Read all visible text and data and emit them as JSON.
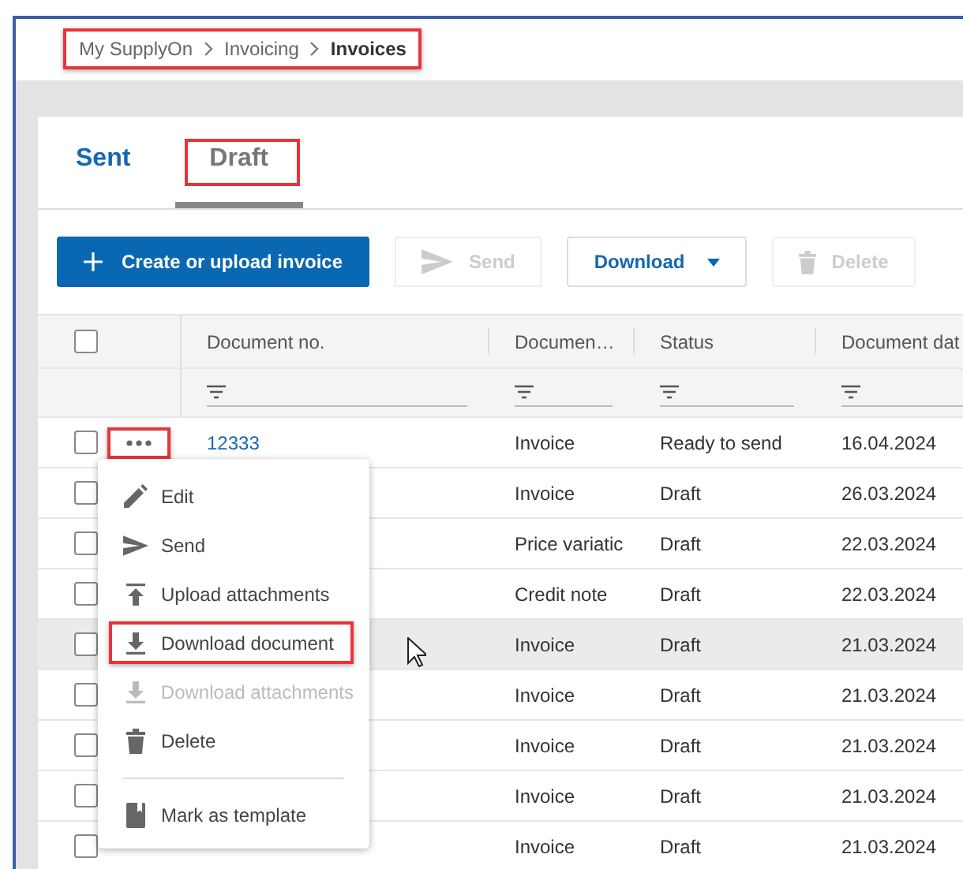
{
  "breadcrumb": {
    "highlighted": true,
    "items": [
      "My SupplyOn",
      "Invoicing",
      "Invoices"
    ]
  },
  "tabs": [
    {
      "label": "Sent",
      "selected": false,
      "highlighted": false
    },
    {
      "label": "Draft",
      "selected": true,
      "highlighted": true
    }
  ],
  "toolbar": [
    {
      "kind": "create",
      "label": "Create or upload invoice",
      "disabled": false
    },
    {
      "kind": "send",
      "label": "Send",
      "disabled": true
    },
    {
      "kind": "download",
      "label": "Download",
      "disabled": false
    },
    {
      "kind": "delete",
      "label": "Delete",
      "disabled": true
    }
  ],
  "table": {
    "select_all_checked": false,
    "columns": [
      "Document no.",
      "Documen…",
      "Status",
      "Document dat"
    ],
    "rows": [
      {
        "checked": false,
        "hovered": false,
        "document_no": "12333",
        "document_type": "Invoice",
        "status": "Ready to send",
        "document_date": "16.04.2024",
        "more_highlighted": true
      },
      {
        "checked": false,
        "hovered": false,
        "document_type": "Invoice",
        "status": "Draft",
        "document_date": "26.03.2024"
      },
      {
        "checked": false,
        "hovered": false,
        "document_type": "Price variatic",
        "status": "Draft",
        "document_date": "22.03.2024"
      },
      {
        "checked": false,
        "hovered": false,
        "document_type": "Credit note",
        "status": "Draft",
        "document_date": "22.03.2024"
      },
      {
        "checked": false,
        "hovered": true,
        "document_type": "Invoice",
        "status": "Draft",
        "document_date": "21.03.2024"
      },
      {
        "checked": false,
        "hovered": false,
        "document_type": "Invoice",
        "status": "Draft",
        "document_date": "21.03.2024"
      },
      {
        "checked": false,
        "hovered": false,
        "document_type": "Invoice",
        "status": "Draft",
        "document_date": "21.03.2024"
      },
      {
        "checked": false,
        "hovered": false,
        "document_type": "Invoice",
        "status": "Draft",
        "document_date": "21.03.2024"
      },
      {
        "checked": false,
        "hovered": false,
        "document_type": "Invoice",
        "status": "Draft",
        "document_date": "21.03.2024"
      }
    ]
  },
  "context_menu": [
    {
      "kind": "edit",
      "label": "Edit",
      "disabled": false,
      "highlighted": false
    },
    {
      "kind": "send",
      "label": "Send",
      "disabled": false,
      "highlighted": false
    },
    {
      "kind": "upload",
      "label": "Upload attachments",
      "disabled": false,
      "highlighted": false
    },
    {
      "kind": "download",
      "label": "Download document",
      "disabled": false,
      "highlighted": true
    },
    {
      "kind": "download",
      "label": "Download attachments",
      "disabled": true,
      "highlighted": false
    },
    {
      "kind": "delete",
      "label": "Delete",
      "disabled": false,
      "highlighted": false
    },
    {
      "kind": "template",
      "label": "Mark as template",
      "disabled": false,
      "highlighted": false,
      "divider_before": true
    }
  ]
}
